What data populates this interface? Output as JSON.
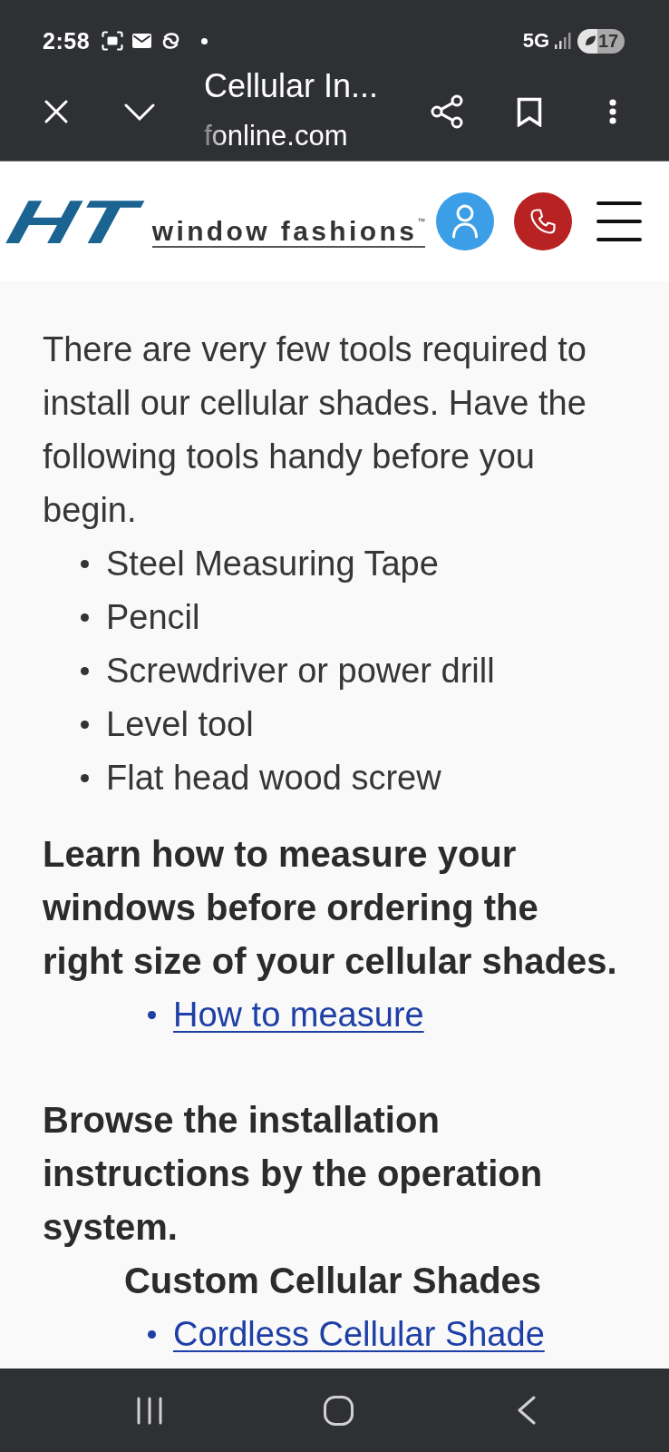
{
  "status_bar": {
    "time": "2:58",
    "network": "5G",
    "battery": "17"
  },
  "browser_toolbar": {
    "title": "Cellular In...",
    "url": "fonline.com"
  },
  "site_header": {
    "logo_mark": "HT",
    "logo_text": "window fashions$^{™}$"
  },
  "content": [
    {
      "kind": "paragraph",
      "text": "There are very few tools required to install our cellular shades. Have the following tools handy before you begin."
    },
    {
      "kind": "bullets",
      "items": [
        "Steel Measuring Tape",
        "Pencil",
        "Screwdriver or power drill",
        "Level tool",
        "Flat head wood screw"
      ]
    },
    {
      "kind": "heading",
      "text": "Learn how to measure your windows before ordering the right size of your cellular shades."
    },
    {
      "kind": "links",
      "items": [
        "How to measure"
      ]
    },
    {
      "kind": "heading",
      "text": "Browse the installation instructions by the operation system."
    },
    {
      "kind": "subheading",
      "text": "Custom Cellular Shades"
    },
    {
      "kind": "links",
      "items": [
        "Cordless Cellular Shade"
      ]
    }
  ]
}
